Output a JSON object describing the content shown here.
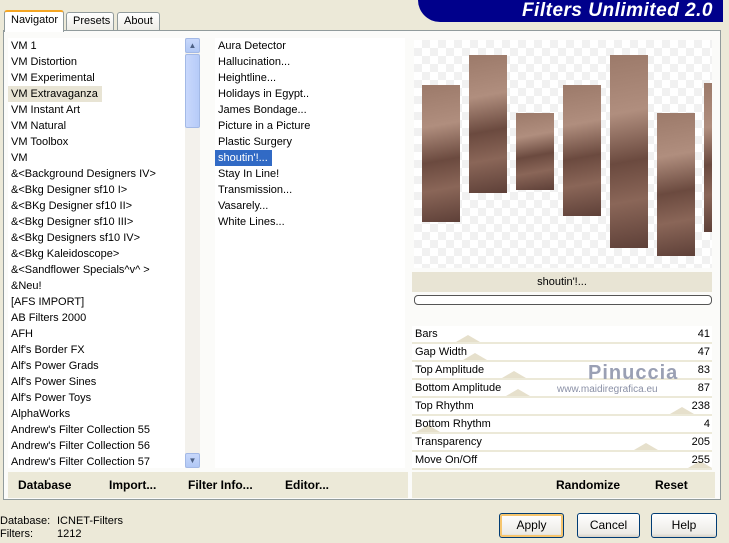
{
  "tabs": [
    "Navigator",
    "Presets",
    "About"
  ],
  "banner": "Filters Unlimited 2.0",
  "categories": [
    "VM 1",
    "VM Distortion",
    "VM Experimental",
    "VM Extravaganza",
    "VM Instant Art",
    "VM Natural",
    "VM Toolbox",
    "VM",
    "&<Background Designers IV>",
    "&<Bkg Designer sf10 I>",
    "&<BKg Designer sf10 II>",
    "&<Bkg Designer sf10 III>",
    "&<Bkg Designers sf10 IV>",
    "&<Bkg Kaleidoscope>",
    "&<Sandflower Specials^v^ >",
    "&Neu!",
    "[AFS IMPORT]",
    "AB Filters 2000",
    "AFH",
    "Alf's Border FX",
    "Alf's Power Grads",
    "Alf's Power Sines",
    "Alf's Power Toys",
    "AlphaWorks",
    "Andrew's Filter Collection 55",
    "Andrew's Filter Collection 56",
    "Andrew's Filter Collection 57"
  ],
  "selected_category": "VM Extravaganza",
  "filters": [
    " Aura Detector",
    "Hallucination...",
    "Heightline...",
    "Holidays in Egypt..",
    "James Bondage...",
    "Picture in a Picture",
    "Plastic Surgery",
    "shoutin'!...",
    "Stay In Line!",
    "Transmission...",
    "Vasarely...",
    "White Lines..."
  ],
  "selected_filter": "shoutin'!...",
  "filter_name": "shoutin'!...",
  "progress": 0,
  "sliders": [
    {
      "label": "Bars",
      "value": 41
    },
    {
      "label": "Gap Width",
      "value": 47
    },
    {
      "label": "Top Amplitude",
      "value": 83
    },
    {
      "label": "Bottom Amplitude",
      "value": 87
    },
    {
      "label": "Top Rhythm",
      "value": 238
    },
    {
      "label": "Bottom Rhythm",
      "value": 4
    },
    {
      "label": "Transparency",
      "value": 205
    },
    {
      "label": "Move On/Off",
      "value": 255
    }
  ],
  "slider_max": 255,
  "watermark": {
    "name": "Pinuccia",
    "url": "www.maidiregrafica.eu"
  },
  "buttons": {
    "database": "Database",
    "import": "Import...",
    "filter_info": "Filter Info...",
    "editor": "Editor...",
    "randomize": "Randomize",
    "reset": "Reset",
    "apply": "Apply",
    "cancel": "Cancel",
    "help": "Help"
  },
  "status": {
    "database_label": "Database:",
    "database_value": "ICNET-Filters",
    "filters_label": "Filters:",
    "filters_value": "1212"
  },
  "colors": {
    "banner": "#00008b",
    "selection": "#316ac5"
  }
}
